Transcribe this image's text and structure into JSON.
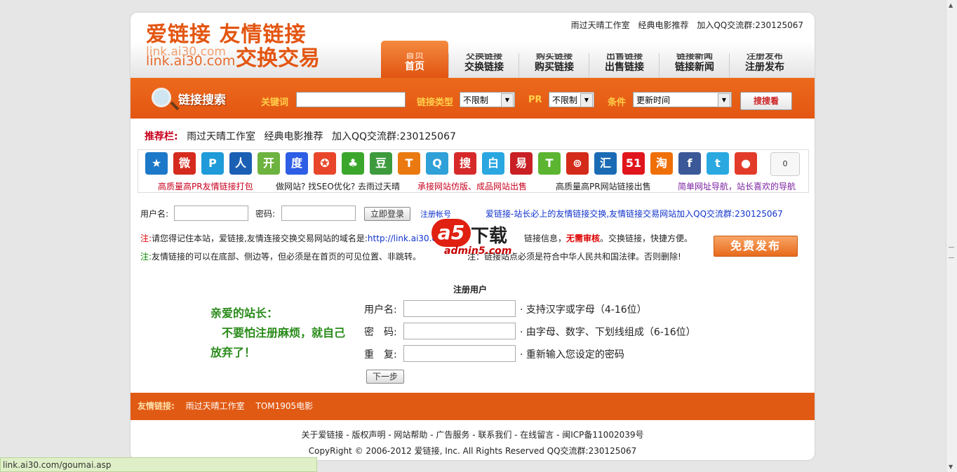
{
  "logo": {
    "line1": "爱链接 友情链接",
    "url1": "link.ai30.com",
    "url2": "link.ai30.com",
    "line2": "交换交易"
  },
  "toplinks": [
    "雨过天晴工作室",
    "经典电影推荐",
    "加入QQ交流群:230125067"
  ],
  "nav": [
    {
      "ghost": "首页",
      "label": "首页"
    },
    {
      "ghost": "交换链接",
      "label": "交换链接"
    },
    {
      "ghost": "购买链接",
      "label": "购买链接"
    },
    {
      "ghost": "出售链接",
      "label": "出售链接"
    },
    {
      "ghost": "链接新闻",
      "label": "链接新闻"
    },
    {
      "ghost": "注册发布",
      "label": "注册发布"
    }
  ],
  "search": {
    "title": "链接搜索",
    "keyword_label": "关键词",
    "keyword_value": "",
    "type_label": "链接类型",
    "type_value": "不限制",
    "pr_label": "PR",
    "pr_value": "不限制",
    "cond_label": "条件",
    "cond_value": "更新时间",
    "button": "搜搜看"
  },
  "recommend": {
    "label": "推荐栏:",
    "items": [
      "雨过天晴工作室",
      "经典电影推荐",
      "加入QQ交流群:230125067"
    ]
  },
  "icons": [
    {
      "name": "qzone-icon",
      "color": "#1c78c8",
      "glyph": "★"
    },
    {
      "name": "weibo-icon",
      "color": "#d52b1e",
      "glyph": "微"
    },
    {
      "name": "pengyou-icon",
      "color": "#1e9bd8",
      "glyph": "P"
    },
    {
      "name": "renren-icon",
      "color": "#1a5fb4",
      "glyph": "人"
    },
    {
      "name": "kaixin-icon",
      "color": "#6db33f",
      "glyph": "开"
    },
    {
      "name": "baidu-icon",
      "color": "#2d5ee5",
      "glyph": "度"
    },
    {
      "name": "star-icon",
      "color": "#e8452a",
      "glyph": "✪"
    },
    {
      "name": "clover-icon",
      "color": "#3aa72c",
      "glyph": "♣"
    },
    {
      "name": "douban-icon",
      "color": "#3d9b3d",
      "glyph": "豆"
    },
    {
      "name": "tianya-icon",
      "color": "#ea7a10",
      "glyph": "T"
    },
    {
      "name": "qq-weibo-icon",
      "color": "#2fa0d8",
      "glyph": "Q"
    },
    {
      "name": "sohu-icon",
      "color": "#d62a2a",
      "glyph": "搜"
    },
    {
      "name": "baidu-bai-icon",
      "color": "#2aa6e0",
      "glyph": "白"
    },
    {
      "name": "163-icon",
      "color": "#c82024",
      "glyph": "易"
    },
    {
      "name": "tencent-t-icon",
      "color": "#5cb531",
      "glyph": "T"
    },
    {
      "name": "netease-swirl-icon",
      "color": "#d42a1a",
      "glyph": "⊚"
    },
    {
      "name": "huijia-icon",
      "color": "#1b6bb4",
      "glyph": "汇"
    },
    {
      "name": "51-icon",
      "color": "#e0161c",
      "glyph": "51"
    },
    {
      "name": "taobao-icon",
      "color": "#ef6f09",
      "glyph": "淘"
    },
    {
      "name": "facebook-icon",
      "color": "#3b5998",
      "glyph": "f"
    },
    {
      "name": "twitter-icon",
      "color": "#2aa9e0",
      "glyph": "t"
    },
    {
      "name": "apple-icon",
      "color": "#e23b2a",
      "glyph": "●"
    }
  ],
  "share_count": "0",
  "promos": [
    {
      "text": "高质量高PR友情链接打包",
      "color": "#c8001c"
    },
    {
      "text": "做网站? 找SEO优化? 去雨过天晴",
      "color": "#222222"
    },
    {
      "text": "承接网站仿版、成品网站出售",
      "color": "#c8001c"
    },
    {
      "text": "高质量高PR网站链接出售",
      "color": "#222222"
    },
    {
      "text": "简单网址导航，站长喜欢的导航",
      "color": "#7a1fa0"
    }
  ],
  "login": {
    "user_label": "用户名:",
    "pass_label": "密码:",
    "button": "立即登录",
    "register": "注册帐号",
    "slogan": "爱链接-站长必上的友情链接交换,友情链接交易网站加入QQ交流群:230125067"
  },
  "notes": [
    {
      "prefix": "注:",
      "text": "请您得记住本站，爱链接,友情连接交换交易网站的域名是:",
      "link": "http://link.ai30.com",
      "rest": "链接信息，",
      "emph": "无需审核",
      "tail": "。交换链接，快捷方便。"
    },
    {
      "prefix": "注:",
      "text": "友情链接的可以在底部、侧边等，但必须是在首页的可见位置、非跳转。",
      "link": "",
      "rest": "注：链接站点必须是符合中华人民共和国法律。否则删除!",
      "emph": "",
      "tail": ""
    }
  ],
  "watermark": {
    "a": "a5",
    "xz": "下载",
    "site": "admin5.com"
  },
  "free_button": "免费发布",
  "register": {
    "title": "注册用户",
    "greet": [
      "亲爱的站长：",
      "不要怕注册麻烦，就自己",
      "放弃了！"
    ],
    "rows": [
      {
        "label": "用户名:",
        "hint": "· 支持汉字或字母（4-16位）"
      },
      {
        "label": "密　码:",
        "hint": "· 由字母、数字、下划线组成（6-16位）"
      },
      {
        "label": "重　复:",
        "hint": "· 重新输入您设定的密码"
      }
    ],
    "next": "下一步"
  },
  "friends": {
    "label": "友情链接:",
    "items": [
      "雨过天晴工作室",
      "TOM1905电影"
    ]
  },
  "footer": {
    "links": "关于爱链接 - 版权声明 - 网站帮助 - 广告服务 - 联系我们 - 在线留言 - 闽ICP备11002039号",
    "copyright": "CopyRight © 2006-2012 爱链接, Inc. All Rights Reserved QQ交流群:230125067"
  },
  "status_url": "link.ai30.com/goumai.asp"
}
